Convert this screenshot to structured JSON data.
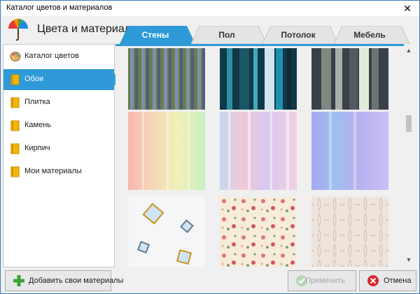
{
  "window": {
    "title": "Каталог цветов и материалов",
    "close_glyph": "✕"
  },
  "header": {
    "title": "Цвета и материалы",
    "logo": "umbrella-palette-icon"
  },
  "tabs": [
    {
      "label": "Стены",
      "active": true
    },
    {
      "label": "Пол",
      "active": false
    },
    {
      "label": "Потолок",
      "active": false
    },
    {
      "label": "Мебель",
      "active": false
    }
  ],
  "sidebar": {
    "items": [
      {
        "label": "Каталог цветов",
        "icon": "palette-icon",
        "active": false
      },
      {
        "label": "Обои",
        "icon": "book-icon",
        "active": true
      },
      {
        "label": "Плитка",
        "icon": "book-icon",
        "active": false
      },
      {
        "label": "Камень",
        "icon": "book-icon",
        "active": false
      },
      {
        "label": "Кирпич",
        "icon": "book-icon",
        "active": false
      },
      {
        "label": "Мои материалы",
        "icon": "book-icon",
        "active": false
      }
    ]
  },
  "footer": {
    "add_label": "Добавить свои материалы",
    "apply_label": "Применить",
    "cancel_label": "Отмена"
  },
  "colors": {
    "accent": "#2f9ad8",
    "tab_inactive": "#e4e4e4",
    "add_icon": "#3aa33a",
    "cancel_icon": "#d8262a"
  }
}
